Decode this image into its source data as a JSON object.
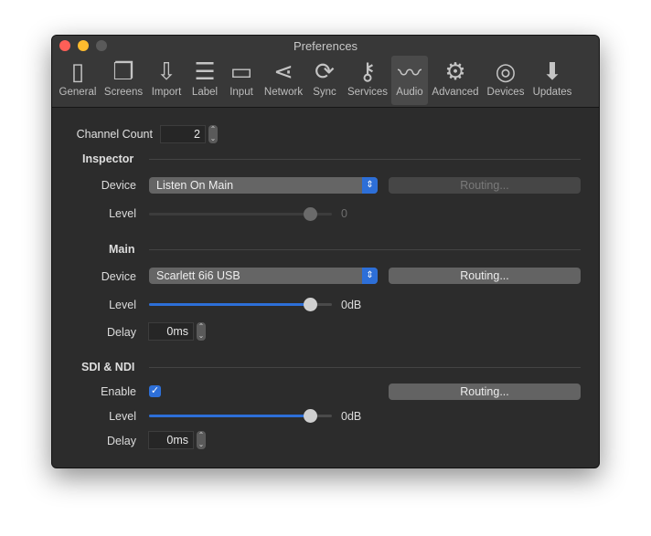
{
  "window": {
    "title": "Preferences"
  },
  "toolbar": [
    {
      "label": "General",
      "icon": "general-icon"
    },
    {
      "label": "Screens",
      "icon": "screens-icon"
    },
    {
      "label": "Import",
      "icon": "import-icon"
    },
    {
      "label": "Label",
      "icon": "label-icon"
    },
    {
      "label": "Input",
      "icon": "input-icon"
    },
    {
      "label": "Network",
      "icon": "network-icon"
    },
    {
      "label": "Sync",
      "icon": "sync-icon"
    },
    {
      "label": "Services",
      "icon": "key-icon"
    },
    {
      "label": "Audio",
      "icon": "waveform-icon",
      "selected": true
    },
    {
      "label": "Advanced",
      "icon": "gear-icon"
    },
    {
      "label": "Devices",
      "icon": "antenna-icon"
    },
    {
      "label": "Updates",
      "icon": "download-icon"
    }
  ],
  "channel_count": {
    "label": "Channel Count",
    "value": "2"
  },
  "inspector": {
    "title": "Inspector",
    "device_label": "Device",
    "device": "Listen On Main",
    "routing": "Routing...",
    "level_label": "Level",
    "level_value": "0",
    "level_fraction": 0.88,
    "enabled": false
  },
  "main": {
    "title": "Main",
    "device_label": "Device",
    "device": "Scarlett 6i6 USB",
    "routing": "Routing...",
    "level_label": "Level",
    "level_value": "0dB",
    "level_fraction": 0.88,
    "delay_label": "Delay",
    "delay": "0ms"
  },
  "sdi": {
    "title": "SDI & NDI",
    "enable_label": "Enable",
    "enabled": true,
    "routing": "Routing...",
    "level_label": "Level",
    "level_value": "0dB",
    "level_fraction": 0.88,
    "delay_label": "Delay",
    "delay": "0ms"
  },
  "colors": {
    "accent": "#2d6fd8",
    "background": "#2c2c2c"
  }
}
